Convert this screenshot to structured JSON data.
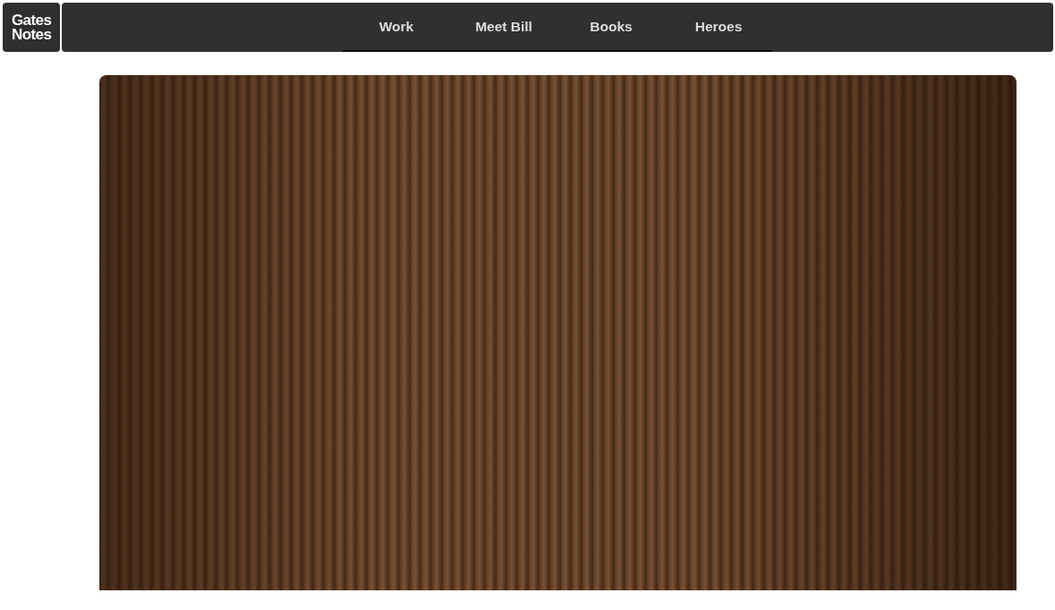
{
  "header": {
    "logo": "Gates Notes",
    "nav": [
      {
        "label": "Work"
      },
      {
        "label": "Meet Bill"
      },
      {
        "label": "Books"
      },
      {
        "label": "Heroes"
      }
    ]
  },
  "media": {
    "kind": "photo"
  }
}
